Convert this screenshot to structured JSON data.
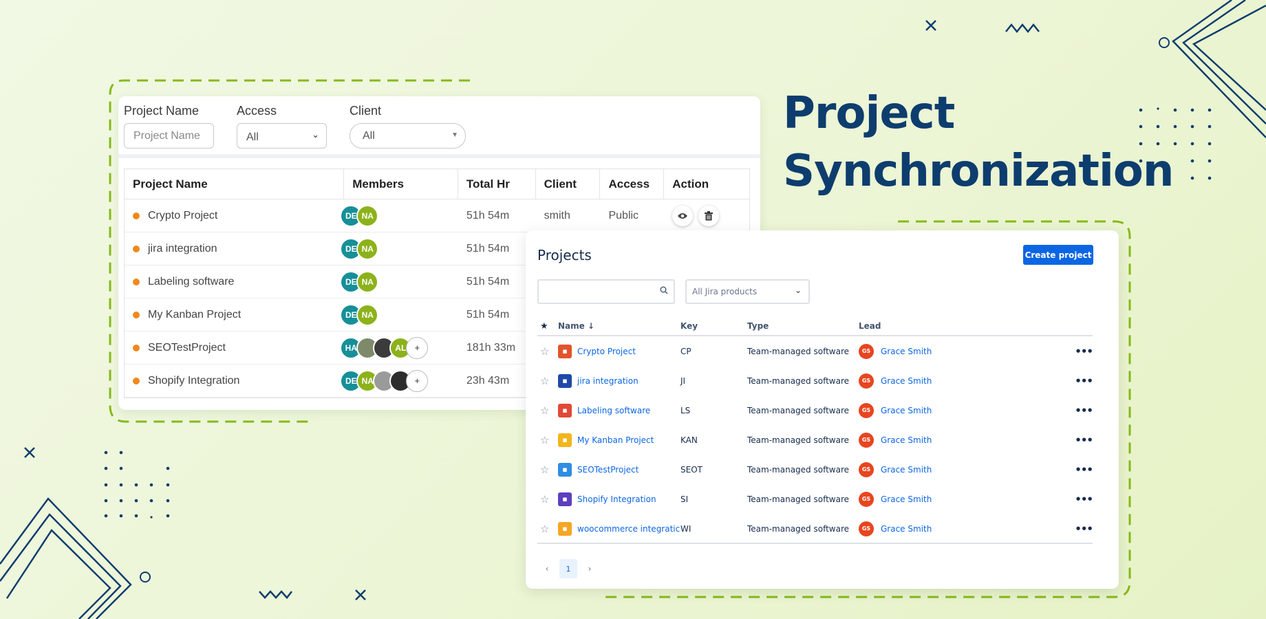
{
  "headline": {
    "line1": "Project",
    "line2": "Synchronization"
  },
  "left_app": {
    "filters": {
      "project_name_label": "Project Name",
      "project_name_placeholder": "Project Name",
      "access_label": "Access",
      "access_value": "All",
      "client_label": "Client",
      "client_value": "All"
    },
    "columns": [
      "Project Name",
      "Members",
      "Total Hr",
      "Client",
      "Access",
      "Action"
    ],
    "rows": [
      {
        "name": "Crypto Project",
        "total": "51h 54m",
        "client": "smith",
        "access": "Public",
        "members": [
          {
            "label": "DE",
            "color": "#168f98"
          },
          {
            "label": "NA",
            "color": "#8cb21a"
          }
        ]
      },
      {
        "name": "jira integration",
        "total": "51h 54m",
        "client": "",
        "access": "",
        "members": [
          {
            "label": "DE",
            "color": "#168f98"
          },
          {
            "label": "NA",
            "color": "#8cb21a"
          }
        ]
      },
      {
        "name": "Labeling software",
        "total": "51h 54m",
        "client": "",
        "access": "",
        "members": [
          {
            "label": "DE",
            "color": "#168f98"
          },
          {
            "label": "NA",
            "color": "#8cb21a"
          }
        ]
      },
      {
        "name": "My Kanban Project",
        "total": "51h 54m",
        "client": "",
        "access": "",
        "members": [
          {
            "label": "DE",
            "color": "#168f98"
          },
          {
            "label": "NA",
            "color": "#8cb21a"
          }
        ]
      },
      {
        "name": "SEOTestProject",
        "total": "181h 33m",
        "client": "",
        "access": "",
        "members": [
          {
            "label": "HA",
            "color": "#168f98"
          },
          {
            "label": "",
            "color": "#7d8a6a"
          },
          {
            "label": "",
            "color": "#3b3b3b"
          },
          {
            "label": "AL",
            "color": "#8cb21a"
          },
          {
            "label": "+",
            "color": "#ffffff"
          }
        ]
      },
      {
        "name": "Shopify Integration",
        "total": "23h 43m",
        "client": "",
        "access": "",
        "members": [
          {
            "label": "DE",
            "color": "#168f98"
          },
          {
            "label": "NA",
            "color": "#8cb21a"
          },
          {
            "label": "",
            "color": "#9a9a9a"
          },
          {
            "label": "",
            "color": "#2d2d2d"
          },
          {
            "label": "+",
            "color": "#ffffff"
          }
        ]
      }
    ],
    "actions": {
      "view_icon": "eye-icon",
      "delete_icon": "trash-icon"
    }
  },
  "jira": {
    "title": "Projects",
    "create_label": "Create project",
    "search_icon": "search-icon",
    "filter_value": "All Jira products",
    "columns": {
      "name": "Name ↓",
      "key": "Key",
      "type": "Type",
      "lead": "Lead"
    },
    "rows": [
      {
        "name": "Crypto Project",
        "key": "CP",
        "type": "Team-managed software",
        "lead": "Grace Smith",
        "lead_initials": "GS",
        "icon_color": "#e2542a"
      },
      {
        "name": "jira integration",
        "key": "JI",
        "type": "Team-managed software",
        "lead": "Grace Smith",
        "lead_initials": "GS",
        "icon_color": "#1f4aa8"
      },
      {
        "name": "Labeling software",
        "key": "LS",
        "type": "Team-managed software",
        "lead": "Grace Smith",
        "lead_initials": "GS",
        "icon_color": "#e34935"
      },
      {
        "name": "My Kanban Project",
        "key": "KAN",
        "type": "Team-managed software",
        "lead": "Grace Smith",
        "lead_initials": "GS",
        "icon_color": "#f2b51c"
      },
      {
        "name": "SEOTestProject",
        "key": "SEOT",
        "type": "Team-managed software",
        "lead": "Grace Smith",
        "lead_initials": "GS",
        "icon_color": "#2f8de4"
      },
      {
        "name": "Shopify Integration",
        "key": "SI",
        "type": "Team-managed software",
        "lead": "Grace Smith",
        "lead_initials": "GS",
        "icon_color": "#5d3fbf"
      },
      {
        "name": "woocommerce integratic",
        "key": "WI",
        "type": "Team-managed software",
        "lead": "Grace Smith",
        "lead_initials": "GS",
        "icon_color": "#f5a623"
      }
    ],
    "pagination": {
      "current": "1"
    }
  },
  "colors": {
    "accent_green": "#86b91a",
    "navy": "#0d3d6e",
    "jira_blue": "#0c66e4"
  }
}
